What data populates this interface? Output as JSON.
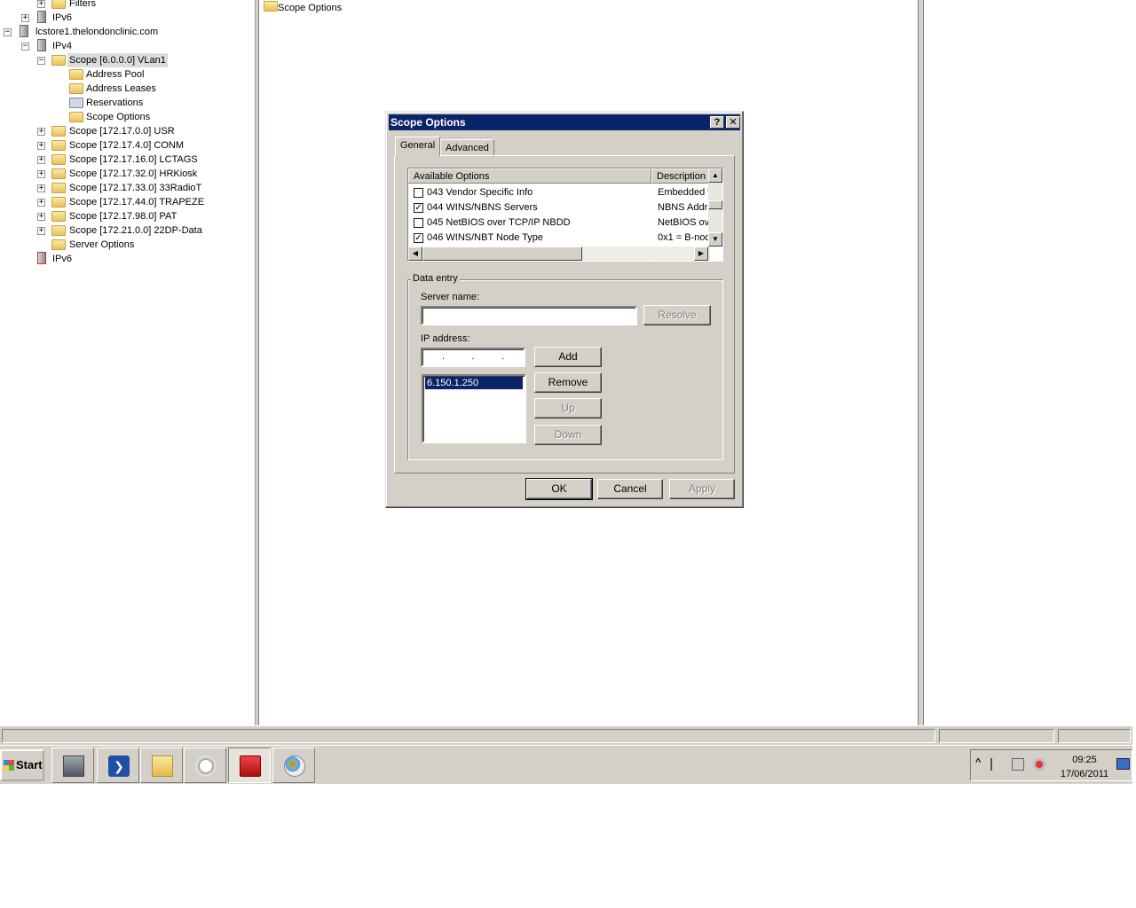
{
  "tree": {
    "rows": [
      {
        "label": "Filters",
        "expander": "+"
      },
      {
        "label": "IPv6",
        "expander": "+"
      },
      {
        "label": "lcstore1.thelondonclinic.com",
        "expander": "−"
      },
      {
        "label": "IPv4",
        "expander": "−"
      },
      {
        "label": "Scope [6.0.0.0] VLan1",
        "expander": "−"
      },
      {
        "label": "Address Pool",
        "expander": ""
      },
      {
        "label": "Address Leases",
        "expander": ""
      },
      {
        "label": "Reservations",
        "expander": ""
      },
      {
        "label": "Scope Options",
        "expander": ""
      },
      {
        "label": "Scope [172.17.0.0] USR",
        "expander": "+"
      },
      {
        "label": "Scope [172.17.4.0] CONM",
        "expander": "+"
      },
      {
        "label": "Scope [172.17.16.0] LCTAGS",
        "expander": "+"
      },
      {
        "label": "Scope [172.17.32.0] HRKiosk",
        "expander": "+"
      },
      {
        "label": "Scope [172.17.33.0] 33RadioT",
        "expander": "+"
      },
      {
        "label": "Scope [172.17.44.0] TRAPEZE",
        "expander": "+"
      },
      {
        "label": "Scope [172.17.98.0] PAT",
        "expander": "+"
      },
      {
        "label": "Scope [172.21.0.0] 22DP-Data",
        "expander": "+"
      },
      {
        "label": "Server Options",
        "expander": ""
      },
      {
        "label": "IPv6",
        "expander": ""
      }
    ]
  },
  "middle": {
    "header_label": "Scope Options"
  },
  "dialog": {
    "title": "Scope Options",
    "help_glyph": "?",
    "close_glyph": "✕",
    "tabs": {
      "general": "General",
      "advanced": "Advanced"
    },
    "options_list": {
      "col_available": "Available Options",
      "col_description": "Description",
      "rows": [
        {
          "name": "043 Vendor Specific Info",
          "desc": "Embedded v",
          "checked": ""
        },
        {
          "name": "044 WINS/NBNS Servers",
          "desc": "NBNS Addr",
          "checked": "✓"
        },
        {
          "name": "045 NetBIOS over TCP/IP NBDD",
          "desc": "NetBIOS ov",
          "checked": ""
        },
        {
          "name": "046 WINS/NBT Node Type",
          "desc": "0x1 = B-nod",
          "checked": "✓"
        }
      ]
    },
    "data_entry": {
      "legend": "Data entry",
      "server_name_label": "Server name:",
      "server_name_value": "",
      "resolve": "Resolve",
      "ip_label": "IP address:",
      "ip_dots": ".          .          .",
      "ip_list": [
        "6.150.1.250"
      ],
      "add": "Add",
      "remove": "Remove",
      "up": "Up",
      "down": "Down"
    },
    "buttons": {
      "ok": "OK",
      "cancel": "Cancel",
      "apply": "Apply"
    }
  },
  "taskbar": {
    "start": "Start",
    "clock_time": "09:25",
    "clock_date": "17/06/2011",
    "tray_expand": "^"
  }
}
